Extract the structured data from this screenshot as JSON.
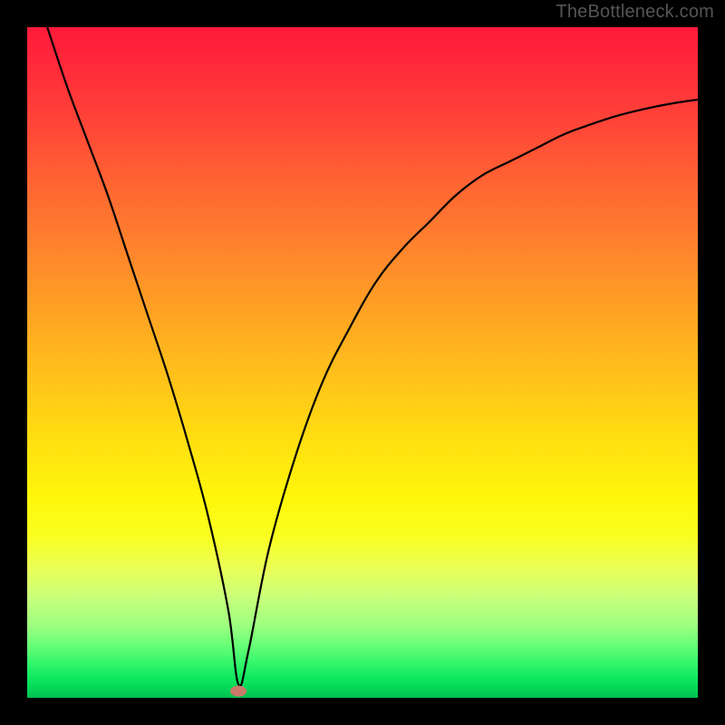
{
  "watermark": "TheBottleneck.com",
  "chart_data": {
    "type": "line",
    "title": "",
    "xlabel": "",
    "ylabel": "",
    "xlim": [
      0,
      100
    ],
    "ylim": [
      0,
      100
    ],
    "grid": false,
    "background_gradient": {
      "top": "#ff1a3a",
      "mid_upper": "#ff9428",
      "mid": "#ffe010",
      "mid_lower": "#c8ff7a",
      "bottom": "#00c050"
    },
    "series": [
      {
        "name": "bottleneck-curve",
        "x": [
          3,
          6,
          9,
          12,
          15,
          18,
          21,
          24,
          27,
          30,
          31.5,
          33,
          36,
          40,
          44,
          48,
          52,
          56,
          60,
          64,
          68,
          72,
          76,
          80,
          84,
          88,
          92,
          96,
          100
        ],
        "y": [
          100,
          91,
          83,
          75,
          66,
          57,
          48,
          38,
          27,
          13,
          2,
          7,
          22,
          36,
          47,
          55,
          62,
          67,
          71,
          75,
          78,
          80,
          82,
          84,
          85.5,
          86.8,
          87.8,
          88.6,
          89.2
        ]
      }
    ],
    "marker": {
      "name": "optimum-point",
      "x": 31.5,
      "y": 1,
      "color": "#c97a6a"
    }
  }
}
